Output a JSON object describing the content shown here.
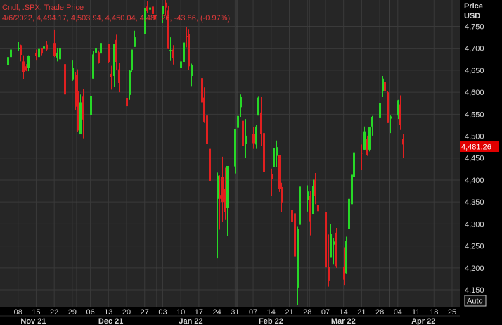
{
  "header": {
    "line1": "Cndl, .SPX, Trade Price",
    "line2": "4/6/2022, 4,494.17, 4,503.94, 4,450.04, 4,481.26, -43.86, (-0.97%)"
  },
  "axis": {
    "price_label": "Price",
    "currency_label": "USD",
    "last_price_tag": "4,481.26",
    "auto_button": "Auto"
  },
  "colors": {
    "background": "#262626",
    "up": "#27d827",
    "down": "#e02020",
    "grid": "#3a3a3a",
    "tag": "#e00000"
  },
  "chart_data": {
    "type": "candlestick",
    "ylim": [
      4110,
      4810
    ],
    "yticks": [
      4150,
      4200,
      4250,
      4300,
      4350,
      4400,
      4450,
      4500,
      4550,
      4600,
      4650,
      4700,
      4750
    ],
    "ytick_labels": [
      "4,150",
      "4,200",
      "4,250",
      "4,300",
      "4,350",
      "4,400",
      "4,450",
      "4,500",
      "4,550",
      "4,600",
      "4,650",
      "4,700",
      "4,750"
    ],
    "xlim": [
      "2021-11-04",
      "2022-03-28"
    ],
    "xticks": [
      {
        "date": "2021-11-08",
        "label": "08"
      },
      {
        "date": "2021-11-15",
        "label": "15"
      },
      {
        "date": "2021-11-22",
        "label": "22"
      },
      {
        "date": "2021-11-29",
        "label": "29"
      },
      {
        "date": "2021-12-06",
        "label": "06"
      },
      {
        "date": "2021-12-13",
        "label": "13"
      },
      {
        "date": "2021-12-20",
        "label": "20"
      },
      {
        "date": "2021-12-27",
        "label": "27"
      },
      {
        "date": "2022-01-03",
        "label": "03"
      },
      {
        "date": "2022-01-10",
        "label": "10"
      },
      {
        "date": "2022-01-17",
        "label": "17"
      },
      {
        "date": "2022-01-24",
        "label": "24"
      },
      {
        "date": "2022-01-31",
        "label": "31"
      },
      {
        "date": "2022-02-07",
        "label": "07"
      },
      {
        "date": "2022-02-14",
        "label": "14"
      },
      {
        "date": "2022-02-21",
        "label": "21"
      },
      {
        "date": "2022-02-28",
        "label": "28"
      },
      {
        "date": "2022-03-07",
        "label": "07"
      },
      {
        "date": "2022-03-14",
        "label": "14"
      },
      {
        "date": "2022-03-21",
        "label": "21"
      },
      {
        "date": "2022-03-28",
        "label": "28"
      },
      {
        "date": "2022-04-04",
        "label": "04"
      },
      {
        "date": "2022-04-11",
        "label": "11"
      },
      {
        "date": "2022-04-18",
        "label": "18"
      },
      {
        "date": "2022-04-25",
        "label": "25"
      }
    ],
    "months": [
      {
        "date": "2021-11-15",
        "label": "Nov 21"
      },
      {
        "date": "2021-12-15",
        "label": "Dec 21"
      },
      {
        "date": "2022-01-15",
        "label": "Jan 22"
      },
      {
        "date": "2022-02-15",
        "label": "Feb 22"
      },
      {
        "date": "2022-03-15",
        "label": "Mar 22"
      },
      {
        "date": "2022-04-15",
        "label": "Apr 22"
      }
    ],
    "month_starts": [
      "2021-12-01",
      "2022-01-01",
      "2022-02-01",
      "2022-03-01",
      "2022-04-01"
    ],
    "candles": [
      {
        "d": "2021-11-04",
        "o": 4662,
        "h": 4685,
        "l": 4650,
        "c": 4680
      },
      {
        "d": "2021-11-05",
        "o": 4680,
        "h": 4718,
        "l": 4673,
        "c": 4697
      },
      {
        "d": "2021-11-08",
        "o": 4701,
        "h": 4714,
        "l": 4694,
        "c": 4701
      },
      {
        "d": "2021-11-09",
        "o": 4707,
        "h": 4708,
        "l": 4670,
        "c": 4685
      },
      {
        "d": "2021-11-10",
        "o": 4670,
        "h": 4684,
        "l": 4630,
        "c": 4646
      },
      {
        "d": "2021-11-11",
        "o": 4659,
        "h": 4664,
        "l": 4648,
        "c": 4649
      },
      {
        "d": "2021-11-12",
        "o": 4656,
        "h": 4684,
        "l": 4648,
        "c": 4682
      },
      {
        "d": "2021-11-15",
        "o": 4689,
        "h": 4697,
        "l": 4672,
        "c": 4682
      },
      {
        "d": "2021-11-16",
        "o": 4680,
        "h": 4714,
        "l": 4679,
        "c": 4700
      },
      {
        "d": "2021-11-17",
        "o": 4701,
        "h": 4701,
        "l": 4684,
        "c": 4688
      },
      {
        "d": "2021-11-18",
        "o": 4700,
        "h": 4708,
        "l": 4672,
        "c": 4704
      },
      {
        "d": "2021-11-19",
        "o": 4708,
        "h": 4717,
        "l": 4694,
        "c": 4697
      },
      {
        "d": "2021-11-22",
        "o": 4712,
        "h": 4743,
        "l": 4680,
        "c": 4682
      },
      {
        "d": "2021-11-23",
        "o": 4679,
        "h": 4701,
        "l": 4670,
        "c": 4690
      },
      {
        "d": "2021-11-24",
        "o": 4675,
        "h": 4702,
        "l": 4659,
        "c": 4701
      },
      {
        "d": "2021-11-26",
        "o": 4664,
        "h": 4664,
        "l": 4585,
        "c": 4595
      },
      {
        "d": "2021-11-29",
        "o": 4628,
        "h": 4672,
        "l": 4626,
        "c": 4655
      },
      {
        "d": "2021-11-30",
        "o": 4640,
        "h": 4646,
        "l": 4560,
        "c": 4567
      },
      {
        "d": "2021-12-01",
        "o": 4602,
        "h": 4652,
        "l": 4510,
        "c": 4513
      },
      {
        "d": "2021-12-02",
        "o": 4504,
        "h": 4595,
        "l": 4504,
        "c": 4577
      },
      {
        "d": "2021-12-03",
        "o": 4590,
        "h": 4608,
        "l": 4495,
        "c": 4538
      },
      {
        "d": "2021-12-06",
        "o": 4548,
        "h": 4612,
        "l": 4541,
        "c": 4591
      },
      {
        "d": "2021-12-07",
        "o": 4631,
        "h": 4694,
        "l": 4631,
        "c": 4686
      },
      {
        "d": "2021-12-08",
        "o": 4690,
        "h": 4705,
        "l": 4674,
        "c": 4701
      },
      {
        "d": "2021-12-09",
        "o": 4691,
        "h": 4695,
        "l": 4665,
        "c": 4667
      },
      {
        "d": "2021-12-10",
        "o": 4688,
        "h": 4713,
        "l": 4670,
        "c": 4712
      },
      {
        "d": "2021-12-13",
        "o": 4710,
        "h": 4710,
        "l": 4667,
        "c": 4669
      },
      {
        "d": "2021-12-14",
        "o": 4642,
        "h": 4660,
        "l": 4606,
        "c": 4634
      },
      {
        "d": "2021-12-15",
        "o": 4637,
        "h": 4710,
        "l": 4612,
        "c": 4709
      },
      {
        "d": "2021-12-16",
        "o": 4719,
        "h": 4731,
        "l": 4651,
        "c": 4669
      },
      {
        "d": "2021-12-17",
        "o": 4652,
        "h": 4667,
        "l": 4600,
        "c": 4621
      },
      {
        "d": "2021-12-20",
        "o": 4587,
        "h": 4587,
        "l": 4531,
        "c": 4568
      },
      {
        "d": "2021-12-21",
        "o": 4594,
        "h": 4651,
        "l": 4583,
        "c": 4649
      },
      {
        "d": "2021-12-22",
        "o": 4650,
        "h": 4697,
        "l": 4645,
        "c": 4697
      },
      {
        "d": "2021-12-23",
        "o": 4703,
        "h": 4740,
        "l": 4703,
        "c": 4725
      },
      {
        "d": "2021-12-27",
        "o": 4733,
        "h": 4791,
        "l": 4733,
        "c": 4791
      },
      {
        "d": "2021-12-28",
        "o": 4795,
        "h": 4807,
        "l": 4780,
        "c": 4786
      },
      {
        "d": "2021-12-29",
        "o": 4788,
        "h": 4804,
        "l": 4778,
        "c": 4793
      },
      {
        "d": "2021-12-30",
        "o": 4795,
        "h": 4808,
        "l": 4775,
        "c": 4778
      },
      {
        "d": "2021-12-31",
        "o": 4775,
        "h": 4787,
        "l": 4765,
        "c": 4766
      },
      {
        "d": "2022-01-03",
        "o": 4778,
        "h": 4796,
        "l": 4758,
        "c": 4796
      },
      {
        "d": "2022-01-04",
        "o": 4804,
        "h": 4818,
        "l": 4774,
        "c": 4793
      },
      {
        "d": "2022-01-05",
        "o": 4787,
        "h": 4797,
        "l": 4699,
        "c": 4700
      },
      {
        "d": "2022-01-06",
        "o": 4693,
        "h": 4725,
        "l": 4671,
        "c": 4696
      },
      {
        "d": "2022-01-07",
        "o": 4697,
        "h": 4707,
        "l": 4663,
        "c": 4677
      },
      {
        "d": "2022-01-10",
        "o": 4655,
        "h": 4673,
        "l": 4582,
        "c": 4670
      },
      {
        "d": "2022-01-11",
        "o": 4669,
        "h": 4714,
        "l": 4638,
        "c": 4713
      },
      {
        "d": "2022-01-12",
        "o": 4728,
        "h": 4749,
        "l": 4702,
        "c": 4726
      },
      {
        "d": "2022-01-13",
        "o": 4733,
        "h": 4744,
        "l": 4650,
        "c": 4659
      },
      {
        "d": "2022-01-14",
        "o": 4637,
        "h": 4665,
        "l": 4614,
        "c": 4662
      },
      {
        "d": "2022-01-18",
        "o": 4632,
        "h": 4632,
        "l": 4568,
        "c": 4577
      },
      {
        "d": "2022-01-19",
        "o": 4588,
        "h": 4611,
        "l": 4530,
        "c": 4533
      },
      {
        "d": "2022-01-20",
        "o": 4547,
        "h": 4603,
        "l": 4482,
        "c": 4483
      },
      {
        "d": "2022-01-21",
        "o": 4471,
        "h": 4494,
        "l": 4395,
        "c": 4398
      },
      {
        "d": "2022-01-24",
        "o": 4357,
        "h": 4417,
        "l": 4222,
        "c": 4410
      },
      {
        "d": "2022-01-25",
        "o": 4366,
        "h": 4411,
        "l": 4287,
        "c": 4357
      },
      {
        "d": "2022-01-26",
        "o": 4408,
        "h": 4453,
        "l": 4305,
        "c": 4350
      },
      {
        "d": "2022-01-27",
        "o": 4380,
        "h": 4428,
        "l": 4309,
        "c": 4327
      },
      {
        "d": "2022-01-28",
        "o": 4336,
        "h": 4432,
        "l": 4273,
        "c": 4432
      },
      {
        "d": "2022-01-31",
        "o": 4431,
        "h": 4516,
        "l": 4415,
        "c": 4516
      },
      {
        "d": "2022-02-01",
        "o": 4519,
        "h": 4546,
        "l": 4483,
        "c": 4546
      },
      {
        "d": "2022-02-02",
        "o": 4566,
        "h": 4595,
        "l": 4544,
        "c": 4589
      },
      {
        "d": "2022-02-03",
        "o": 4535,
        "h": 4542,
        "l": 4470,
        "c": 4478
      },
      {
        "d": "2022-02-04",
        "o": 4482,
        "h": 4539,
        "l": 4451,
        "c": 4501
      },
      {
        "d": "2022-02-07",
        "o": 4505,
        "h": 4521,
        "l": 4471,
        "c": 4484
      },
      {
        "d": "2022-02-08",
        "o": 4481,
        "h": 4526,
        "l": 4471,
        "c": 4522
      },
      {
        "d": "2022-02-09",
        "o": 4547,
        "h": 4590,
        "l": 4547,
        "c": 4588
      },
      {
        "d": "2022-02-10",
        "o": 4554,
        "h": 4589,
        "l": 4477,
        "c": 4505
      },
      {
        "d": "2022-02-11",
        "o": 4507,
        "h": 4527,
        "l": 4401,
        "c": 4419
      },
      {
        "d": "2022-02-14",
        "o": 4413,
        "h": 4426,
        "l": 4364,
        "c": 4402
      },
      {
        "d": "2022-02-15",
        "o": 4429,
        "h": 4472,
        "l": 4429,
        "c": 4472
      },
      {
        "d": "2022-02-16",
        "o": 4455,
        "h": 4490,
        "l": 4429,
        "c": 4475
      },
      {
        "d": "2022-02-17",
        "o": 4456,
        "h": 4456,
        "l": 4373,
        "c": 4380
      },
      {
        "d": "2022-02-18",
        "o": 4384,
        "h": 4394,
        "l": 4327,
        "c": 4349
      },
      {
        "d": "2022-02-22",
        "o": 4332,
        "h": 4362,
        "l": 4267,
        "c": 4304
      },
      {
        "d": "2022-02-23",
        "o": 4324,
        "h": 4324,
        "l": 4221,
        "c": 4226
      },
      {
        "d": "2022-02-24",
        "o": 4155,
        "h": 4295,
        "l": 4115,
        "c": 4288
      },
      {
        "d": "2022-02-25",
        "o": 4298,
        "h": 4385,
        "l": 4287,
        "c": 4385
      },
      {
        "d": "2022-02-28",
        "o": 4355,
        "h": 4388,
        "l": 4328,
        "c": 4374
      },
      {
        "d": "2022-03-01",
        "o": 4364,
        "h": 4375,
        "l": 4274,
        "c": 4306
      },
      {
        "d": "2022-03-02",
        "o": 4323,
        "h": 4401,
        "l": 4323,
        "c": 4387
      },
      {
        "d": "2022-03-03",
        "o": 4401,
        "h": 4416,
        "l": 4345,
        "c": 4363
      },
      {
        "d": "2022-03-04",
        "o": 4343,
        "h": 4359,
        "l": 4291,
        "c": 4329
      },
      {
        "d": "2022-03-07",
        "o": 4327,
        "h": 4327,
        "l": 4199,
        "c": 4201
      },
      {
        "d": "2022-03-08",
        "o": 4202,
        "h": 4276,
        "l": 4157,
        "c": 4171
      },
      {
        "d": "2022-03-09",
        "o": 4223,
        "h": 4299,
        "l": 4223,
        "c": 4278
      },
      {
        "d": "2022-03-10",
        "o": 4253,
        "h": 4268,
        "l": 4209,
        "c": 4260
      },
      {
        "d": "2022-03-11",
        "o": 4280,
        "h": 4291,
        "l": 4200,
        "c": 4204
      },
      {
        "d": "2022-03-14",
        "o": 4203,
        "h": 4247,
        "l": 4161,
        "c": 4173
      },
      {
        "d": "2022-03-15",
        "o": 4188,
        "h": 4271,
        "l": 4187,
        "c": 4262
      },
      {
        "d": "2022-03-16",
        "o": 4288,
        "h": 4358,
        "l": 4251,
        "c": 4357
      },
      {
        "d": "2022-03-17",
        "o": 4345,
        "h": 4412,
        "l": 4335,
        "c": 4412
      },
      {
        "d": "2022-03-18",
        "o": 4407,
        "h": 4465,
        "l": 4390,
        "c": 4463
      },
      {
        "d": "2022-03-21",
        "o": 4462,
        "h": 4481,
        "l": 4424,
        "c": 4461
      },
      {
        "d": "2022-03-22",
        "o": 4469,
        "h": 4522,
        "l": 4469,
        "c": 4511
      },
      {
        "d": "2022-03-23",
        "o": 4493,
        "h": 4501,
        "l": 4455,
        "c": 4456
      },
      {
        "d": "2022-03-24",
        "o": 4469,
        "h": 4520,
        "l": 4465,
        "c": 4520
      },
      {
        "d": "2022-03-25",
        "o": 4522,
        "h": 4546,
        "l": 4501,
        "c": 4543
      },
      {
        "d": "2022-03-28",
        "o": 4541,
        "h": 4575,
        "l": 4517,
        "c": 4575
      },
      {
        "d": "2022-03-29",
        "o": 4602,
        "h": 4637,
        "l": 4589,
        "c": 4631
      },
      {
        "d": "2022-03-30",
        "o": 4624,
        "h": 4627,
        "l": 4581,
        "c": 4602
      },
      {
        "d": "2022-03-31",
        "o": 4600,
        "h": 4603,
        "l": 4530,
        "c": 4530
      },
      {
        "d": "2022-04-01",
        "o": 4540,
        "h": 4547,
        "l": 4507,
        "c": 4545
      },
      {
        "d": "2022-04-04",
        "o": 4547,
        "h": 4583,
        "l": 4539,
        "c": 4582
      },
      {
        "d": "2022-04-05",
        "o": 4572,
        "h": 4593,
        "l": 4514,
        "c": 4525
      },
      {
        "d": "2022-04-06",
        "o": 4494,
        "h": 4504,
        "l": 4450,
        "c": 4481
      }
    ]
  }
}
